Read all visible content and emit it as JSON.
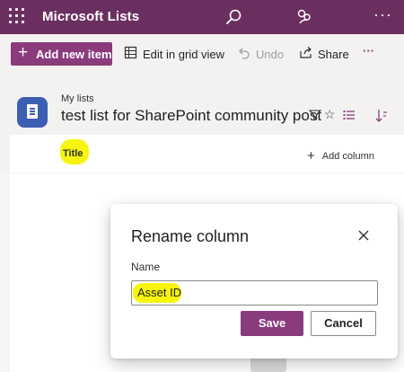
{
  "app": {
    "title": "Microsoft Lists"
  },
  "topbar": {
    "icons": [
      "waffle-icon",
      "search-icon",
      "share-people-icon",
      "more-icon"
    ],
    "more_label": "···"
  },
  "commandbar": {
    "add_new_item": "Add new item",
    "edit_grid": "Edit in grid view",
    "undo": "Undo",
    "share": "Share",
    "more": "···"
  },
  "list": {
    "breadcrumb": "My lists",
    "title": "test list for SharePoint community post"
  },
  "grid": {
    "column_title": "Title",
    "add_column": "Add column"
  },
  "dialog": {
    "title": "Rename column",
    "field_label": "Name",
    "field_value": "Asset ID",
    "save": "Save",
    "cancel": "Cancel"
  },
  "colors": {
    "brand": "#6b2f5f",
    "accent": "#8a3b7c",
    "highlight": "#f7f50f",
    "list_icon": "#3d5fb2"
  }
}
